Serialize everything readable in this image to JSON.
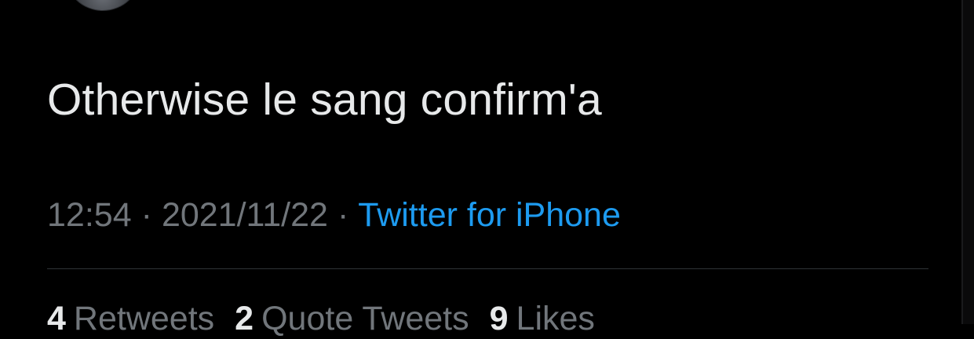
{
  "tweet": {
    "text": "Otherwise le sang confirm'a",
    "time": "12:54",
    "date": "2021/11/22",
    "separator": "·",
    "source": "Twitter for iPhone"
  },
  "stats": {
    "retweets_count": "4",
    "retweets_label": "Retweets",
    "quotes_count": "2",
    "quotes_label": "Quote Tweets",
    "likes_count": "9",
    "likes_label": "Likes"
  },
  "colors": {
    "background": "#000000",
    "text": "#e7e9ea",
    "muted": "#71767b",
    "link": "#1d9bf0",
    "divider": "#2f3336"
  }
}
